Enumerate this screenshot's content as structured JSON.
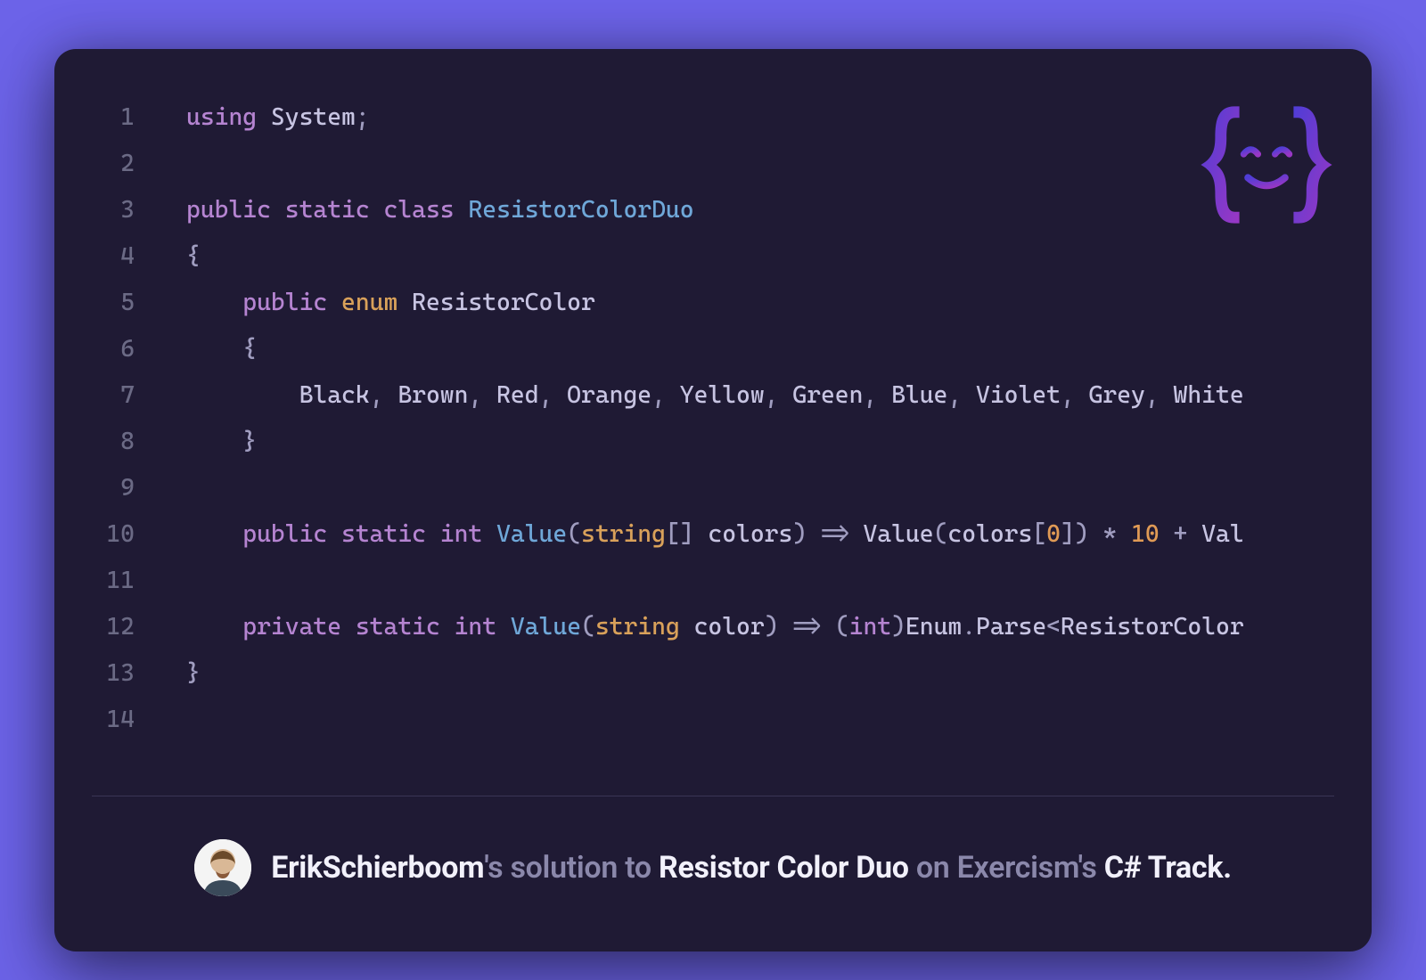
{
  "code": {
    "lines": [
      {
        "n": "1",
        "html": "<span class='k-mod'>using</span> System<span class='punct'>;</span>"
      },
      {
        "n": "2",
        "html": ""
      },
      {
        "n": "3",
        "html": "<span class='k-mod'>public</span> <span class='k-mod'>static</span> <span class='k-mod'>class</span> <span class='k-class'>ResistorColorDuo</span>"
      },
      {
        "n": "4",
        "html": "<span class='punct'>{</span>"
      },
      {
        "n": "5",
        "html": "    <span class='k-mod'>public</span> <span class='k-type'>enum</span> ResistorColor"
      },
      {
        "n": "6",
        "html": "    <span class='punct'>{</span>"
      },
      {
        "n": "7",
        "html": "        Black<span class='punct'>,</span> Brown<span class='punct'>,</span> Red<span class='punct'>,</span> Orange<span class='punct'>,</span> Yellow<span class='punct'>,</span> Green<span class='punct'>,</span> Blue<span class='punct'>,</span> Violet<span class='punct'>,</span> Grey<span class='punct'>,</span> White"
      },
      {
        "n": "8",
        "html": "    <span class='punct'>}</span>"
      },
      {
        "n": "9",
        "html": ""
      },
      {
        "n": "10",
        "html": "    <span class='k-mod'>public</span> <span class='k-mod'>static</span> <span class='k-int'>int</span> <span class='k-func'>Value</span><span class='punct'>(</span><span class='k-str'>string</span><span class='punct'>[]</span> colors<span class='punct'>)</span> <span class='punct'>=&gt;</span> Value<span class='punct'>(</span>colors<span class='punct'>[</span><span class='k-num'>0</span><span class='punct'>])</span> <span class='punct'>*</span> <span class='k-num'>10</span> <span class='punct'>+</span> Val"
      },
      {
        "n": "11",
        "html": ""
      },
      {
        "n": "12",
        "html": "    <span class='k-mod'>private</span> <span class='k-mod'>static</span> <span class='k-int'>int</span> <span class='k-func'>Value</span><span class='punct'>(</span><span class='k-str'>string</span> color<span class='punct'>)</span> <span class='punct'>=&gt;</span> <span class='punct'>(</span><span class='k-int'>int</span><span class='punct'>)</span>Enum<span class='punct'>.</span>Parse<span class='punct'>&lt;</span>ResistorColor"
      },
      {
        "n": "13",
        "html": "<span class='punct'>}</span>"
      },
      {
        "n": "14",
        "html": ""
      }
    ]
  },
  "footer": {
    "author": "ErikSchierboom",
    "s1": "'s ",
    "solution_to": "solution to ",
    "exercise": "Resistor Color Duo",
    "s2": " ",
    "on": "on Exercism's ",
    "track": "C# Track",
    "period": "."
  },
  "colors": {
    "bg": "#6c63e8",
    "card": "#1f1a34",
    "logo_start": "#5b4ad1",
    "logo_end": "#8e3fb8"
  }
}
